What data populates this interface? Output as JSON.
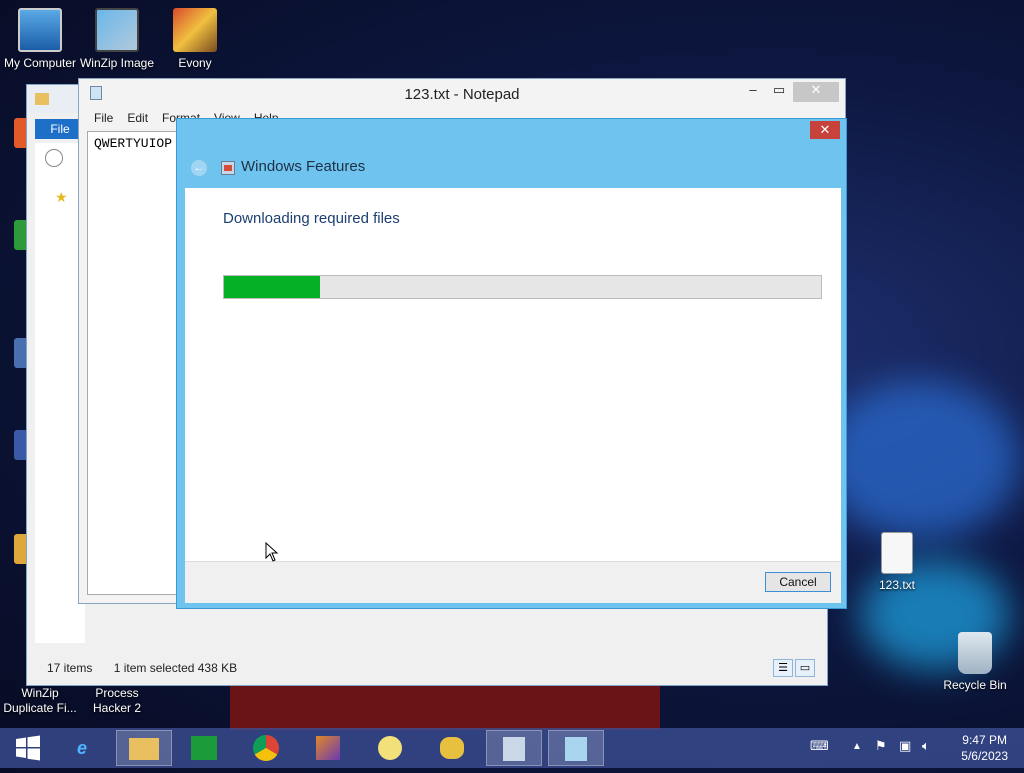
{
  "desktop": {
    "icons_top": [
      {
        "label": "My Computer",
        "icon": "computer-icon"
      },
      {
        "label": "WinZip Image",
        "icon": "winzip-image-icon"
      },
      {
        "label": "Evony",
        "icon": "evony-icon"
      }
    ],
    "icons_bottom": [
      {
        "label": "WinZip Duplicate Fi...",
        "icon": "winzip-duplicate-icon"
      },
      {
        "label": "Process Hacker 2",
        "icon": "process-hacker-icon"
      }
    ],
    "file_icon": {
      "label": "123.txt",
      "icon": "text-file-icon"
    },
    "recycle_bin": {
      "label": "Recycle Bin",
      "icon": "recycle-bin-icon"
    }
  },
  "explorer": {
    "ribbon_tab": "File",
    "status_items": "17 items",
    "status_selected": "1 item selected  438 KB"
  },
  "notepad": {
    "title": "123.txt - Notepad",
    "menu": [
      "File",
      "Edit",
      "Format",
      "View",
      "Help"
    ],
    "content": "QWERTYUIOP"
  },
  "windows_features": {
    "title": "Windows Features",
    "heading": "Downloading required files",
    "progress_percent": 16,
    "cancel_label": "Cancel"
  },
  "taskbar": {
    "clock_time": "9:47 PM",
    "clock_date": "5/6/2023"
  },
  "colors": {
    "progress_fill": "#06b025",
    "dialog_frame": "#6ec4ee",
    "close_red": "#c7423a"
  }
}
